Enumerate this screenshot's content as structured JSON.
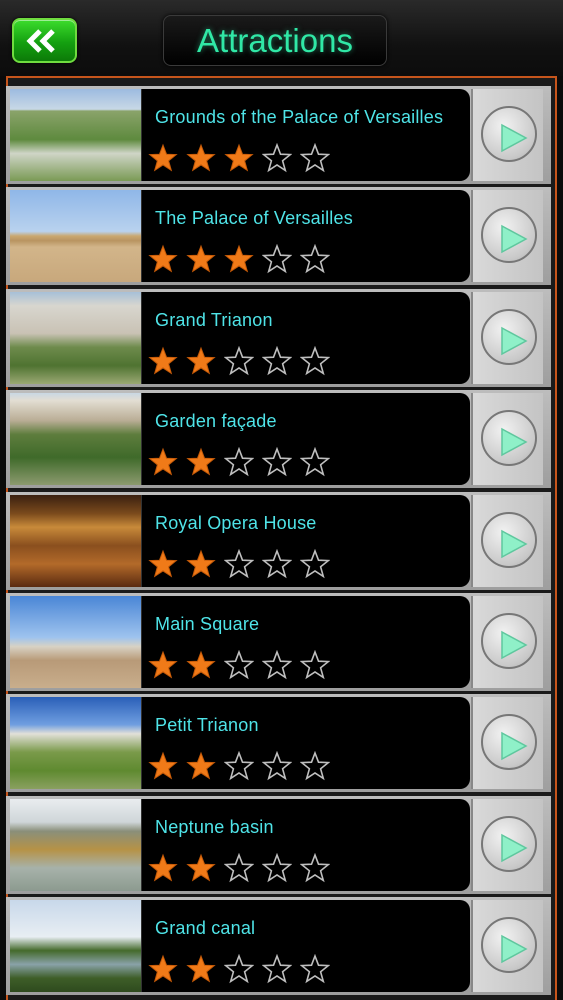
{
  "header": {
    "title": "Attractions",
    "back_icon": "double-chevron-left-icon"
  },
  "colors": {
    "accent_green": "#2ee8a4",
    "label_cyan": "#4fe4e8",
    "star_orange": "#f07a18",
    "frame_orange": "#c6551c"
  },
  "attractions": [
    {
      "name": "Grounds of the Palace of Versailles",
      "rating": 3,
      "max_rating": 5
    },
    {
      "name": "The Palace of Versailles",
      "rating": 3,
      "max_rating": 5
    },
    {
      "name": "Grand Trianon",
      "rating": 2,
      "max_rating": 5
    },
    {
      "name": "Garden façade",
      "rating": 2,
      "max_rating": 5
    },
    {
      "name": "Royal Opera House",
      "rating": 2,
      "max_rating": 5
    },
    {
      "name": "Main Square",
      "rating": 2,
      "max_rating": 5
    },
    {
      "name": "Petit Trianon",
      "rating": 2,
      "max_rating": 5
    },
    {
      "name": "Neptune basin",
      "rating": 2,
      "max_rating": 5
    },
    {
      "name": "Grand canal",
      "rating": 2,
      "max_rating": 5
    }
  ]
}
